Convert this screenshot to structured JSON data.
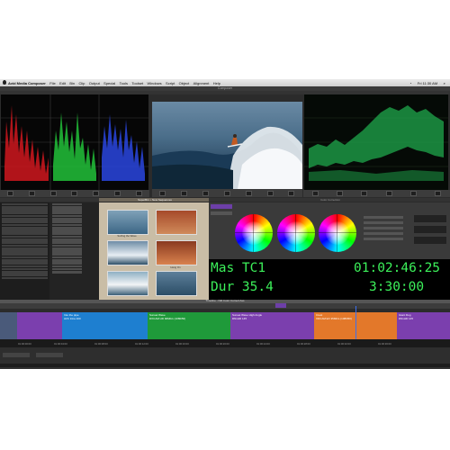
{
  "menubar": {
    "app": "Avid Media Composer",
    "items": [
      "File",
      "Edit",
      "Bin",
      "Clip",
      "Output",
      "Special",
      "Tools",
      "Toolset",
      "Windows",
      "Script",
      "Object",
      "Alignment",
      "Help"
    ],
    "clock": "Fri 11:30 AM"
  },
  "composer": {
    "title": "Composer"
  },
  "superbin": {
    "title": "SuperBin: • New Sequences",
    "thumbs": [
      "Surfing the Wave",
      "",
      "",
      "",
      "Hang On",
      ""
    ]
  },
  "color_correction": {
    "title": "Color Correction"
  },
  "timecode": {
    "row1_label": "Mas TC1",
    "row1_value": "01:02:46:25",
    "row2_label": "Dur 35.4",
    "row2_value": "3:30:00"
  },
  "timeline": {
    "title": "Timeline - NM Color Correct Ass",
    "clips": [
      {
        "name": "Into the pipe",
        "sub": "AVC Intra 100",
        "color": "#7b3fae"
      },
      {
        "name": "Sunset Wave",
        "sub": "DXCAM HD 90Mb/s (1080i50)",
        "color": "#1f9a3a"
      },
      {
        "name": "Sunset Wave High Angle",
        "sub": "DNxHD 145",
        "color": "#7b3fae"
      },
      {
        "name": "Crest",
        "sub": "XDCAM EX 35Mb/s (1080i50)",
        "color": "#e3782a"
      },
      {
        "name": "Giant Dog",
        "sub": "DNxHD 145",
        "color": "#7b3fae"
      }
    ],
    "ruler": [
      "01:00:00:00",
      "01:00:04:00",
      "01:00:08:00",
      "01:00:12:00",
      "01:00:16:00",
      "01:00:20:00",
      "01:00:24:00",
      "01:00:28:00",
      "01:00:32:00",
      "01:00:36:00"
    ]
  },
  "colors": {
    "tc_green": "#3cf05a",
    "panel": "#2b2b2b"
  }
}
